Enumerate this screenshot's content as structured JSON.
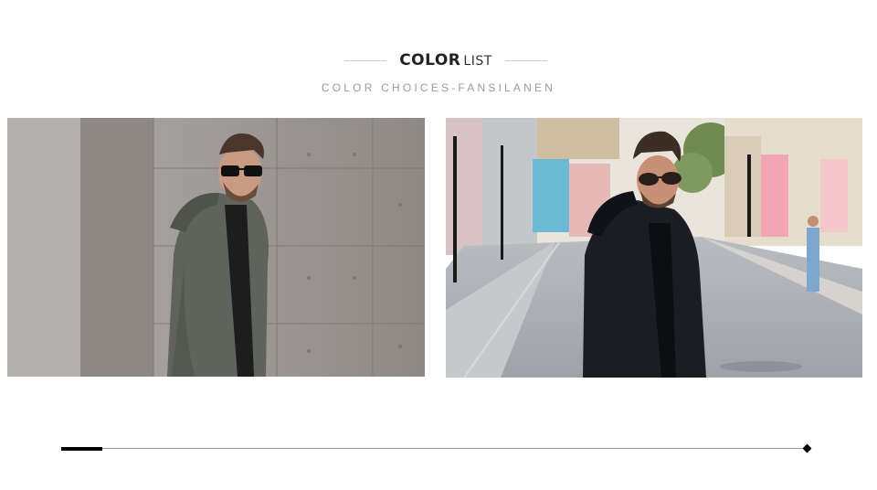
{
  "header": {
    "title_bold": "COLOR",
    "title_light": "LIST",
    "subtitle": "COLOR CHOICES-FANSILANEN"
  },
  "photos": [
    {
      "label": "Man in gray hooded parka against concrete wall",
      "jacket_color": "#5f635c"
    },
    {
      "label": "Man in black hooded parka on city street",
      "jacket_color": "#1b1d22"
    }
  ],
  "scrollbar": {
    "progress": 0.055
  }
}
